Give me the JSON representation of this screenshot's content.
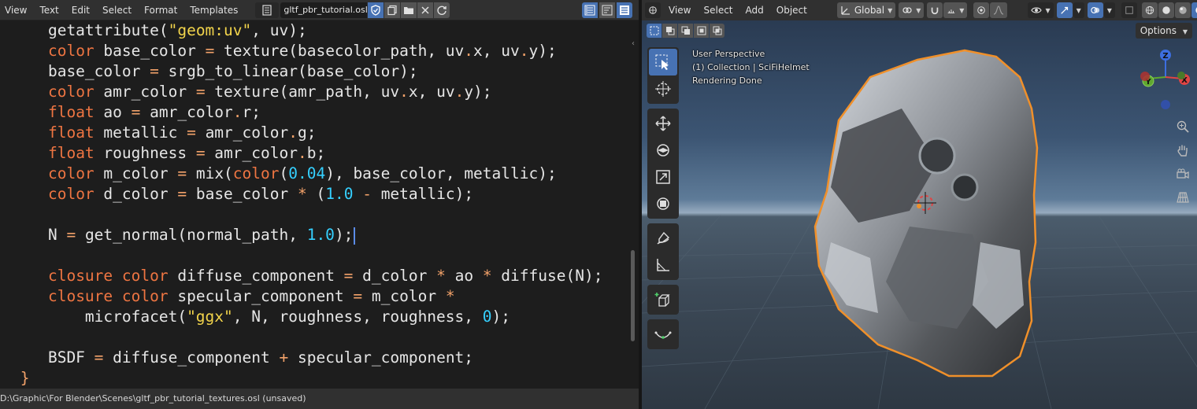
{
  "text_editor": {
    "menu": [
      "View",
      "Text",
      "Edit",
      "Select",
      "Format",
      "Templates"
    ],
    "file_name": "gltf_pbr_tutorial.osl",
    "status_path": "D:\\Graphic\\For Blender\\Scenes\\gltf_pbr_tutorial_textures.osl (unsaved)"
  },
  "code_lines": [
    [
      [
        "t",
        "    getattribute("
      ],
      [
        "s",
        "\"geom:uv\""
      ],
      [
        "t",
        ", uv);"
      ]
    ],
    [
      [
        "t",
        "    "
      ],
      [
        "k",
        "color"
      ],
      [
        "t",
        " base_color "
      ],
      [
        "o",
        "="
      ],
      [
        "t",
        " texture(basecolor_path, uv"
      ],
      [
        "o",
        "."
      ],
      [
        "t",
        "x, uv"
      ],
      [
        "o",
        "."
      ],
      [
        "t",
        "y);"
      ]
    ],
    [
      [
        "t",
        "    base_color "
      ],
      [
        "o",
        "="
      ],
      [
        "t",
        " srgb_to_linear(base_color);"
      ]
    ],
    [
      [
        "t",
        "    "
      ],
      [
        "k",
        "color"
      ],
      [
        "t",
        " amr_color "
      ],
      [
        "o",
        "="
      ],
      [
        "t",
        " texture(amr_path, uv"
      ],
      [
        "o",
        "."
      ],
      [
        "t",
        "x, uv"
      ],
      [
        "o",
        "."
      ],
      [
        "t",
        "y);"
      ]
    ],
    [
      [
        "t",
        "    "
      ],
      [
        "k",
        "float"
      ],
      [
        "t",
        " ao "
      ],
      [
        "o",
        "="
      ],
      [
        "t",
        " amr_color"
      ],
      [
        "o",
        "."
      ],
      [
        "t",
        "r;"
      ]
    ],
    [
      [
        "t",
        "    "
      ],
      [
        "k",
        "float"
      ],
      [
        "t",
        " metallic "
      ],
      [
        "o",
        "="
      ],
      [
        "t",
        " amr_color"
      ],
      [
        "o",
        "."
      ],
      [
        "t",
        "g;"
      ]
    ],
    [
      [
        "t",
        "    "
      ],
      [
        "k",
        "float"
      ],
      [
        "t",
        " roughness "
      ],
      [
        "o",
        "="
      ],
      [
        "t",
        " amr_color"
      ],
      [
        "o",
        "."
      ],
      [
        "t",
        "b;"
      ]
    ],
    [
      [
        "t",
        "    "
      ],
      [
        "k",
        "color"
      ],
      [
        "t",
        " m_color "
      ],
      [
        "o",
        "="
      ],
      [
        "t",
        " mix("
      ],
      [
        "k",
        "color"
      ],
      [
        "t",
        "("
      ],
      [
        "n",
        "0.04"
      ],
      [
        "t",
        "), base_color, metallic);"
      ]
    ],
    [
      [
        "t",
        "    "
      ],
      [
        "k",
        "color"
      ],
      [
        "t",
        " d_color "
      ],
      [
        "o",
        "="
      ],
      [
        "t",
        " base_color "
      ],
      [
        "o",
        "*"
      ],
      [
        "t",
        " ("
      ],
      [
        "n",
        "1.0"
      ],
      [
        "t",
        " "
      ],
      [
        "o",
        "-"
      ],
      [
        "t",
        " metallic);"
      ]
    ],
    [],
    [
      [
        "t",
        "    N "
      ],
      [
        "o",
        "="
      ],
      [
        "t",
        " get_normal(normal_path, "
      ],
      [
        "n",
        "1.0"
      ],
      [
        "t",
        ");"
      ]
    ],
    [],
    [
      [
        "t",
        "    "
      ],
      [
        "k",
        "closure"
      ],
      [
        "t",
        " "
      ],
      [
        "k",
        "color"
      ],
      [
        "t",
        " diffuse_component "
      ],
      [
        "o",
        "="
      ],
      [
        "t",
        " d_color "
      ],
      [
        "o",
        "*"
      ],
      [
        "t",
        " ao "
      ],
      [
        "o",
        "*"
      ],
      [
        "t",
        " diffuse(N);"
      ]
    ],
    [
      [
        "t",
        "    "
      ],
      [
        "k",
        "closure"
      ],
      [
        "t",
        " "
      ],
      [
        "k",
        "color"
      ],
      [
        "t",
        " specular_component "
      ],
      [
        "o",
        "="
      ],
      [
        "t",
        " m_color "
      ],
      [
        "o",
        "*"
      ]
    ],
    [
      [
        "t",
        "        microfacet("
      ],
      [
        "s",
        "\"ggx\""
      ],
      [
        "t",
        ", N, roughness, roughness, "
      ],
      [
        "n",
        "0"
      ],
      [
        "t",
        ");"
      ]
    ],
    [],
    [
      [
        "t",
        "    BSDF "
      ],
      [
        "o",
        "="
      ],
      [
        "t",
        " diffuse_component "
      ],
      [
        "o",
        "+"
      ],
      [
        "t",
        " specular_component;"
      ]
    ],
    [
      [
        "t",
        " "
      ],
      [
        "o",
        "}"
      ]
    ]
  ],
  "viewport": {
    "menu": [
      "View",
      "Select",
      "Add",
      "Object"
    ],
    "transform_orientation": "Global",
    "options_label": "Options",
    "info": {
      "perspective": "User Perspective",
      "collection": "(1) Collection | SciFiHelmet",
      "render_status": "Rendering Done"
    },
    "gizmo_axes": {
      "z": "Z",
      "x": "X",
      "y": "Y"
    }
  },
  "colors": {
    "keyword": "#ee7542",
    "string": "#f2d44b",
    "number": "#35d0ff",
    "operator": "#f3a26a",
    "text": "#e6e6e6",
    "accent": "#4772b3",
    "selection_outline": "#f0902a"
  }
}
